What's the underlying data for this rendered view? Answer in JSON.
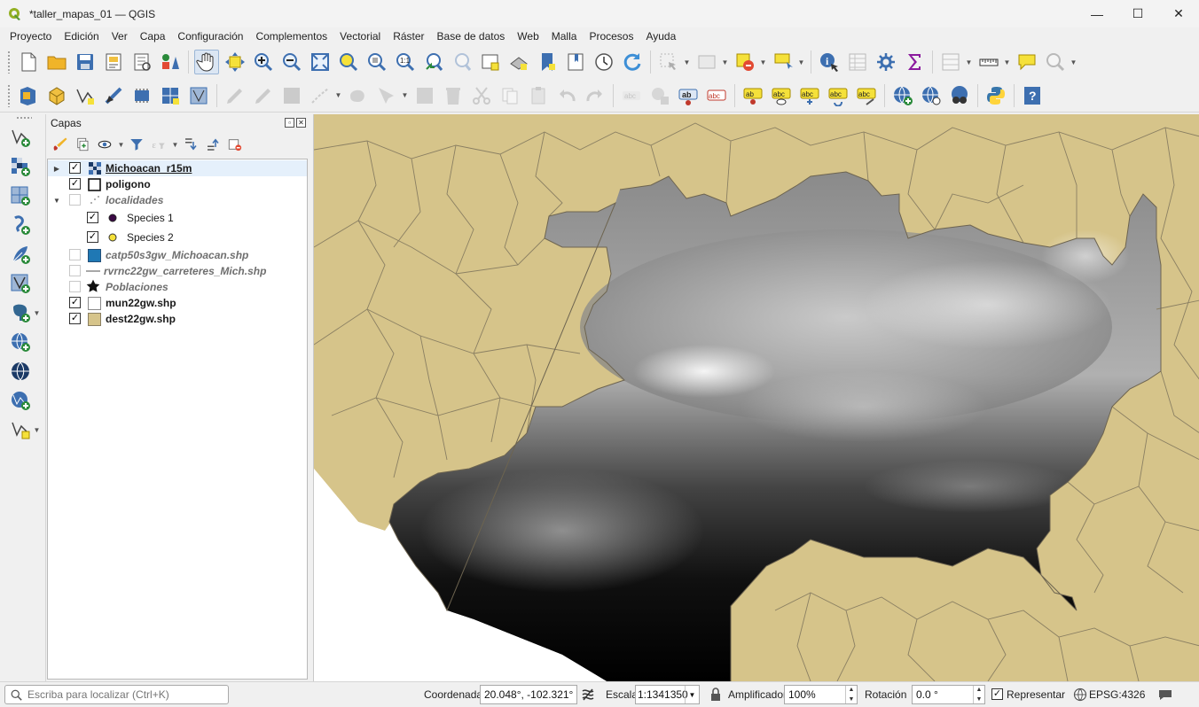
{
  "window": {
    "title": "*taller_mapas_01 — QGIS",
    "minimize": "—",
    "maximize": "☐",
    "close": "✕"
  },
  "menu": [
    "Proyecto",
    "Edición",
    "Ver",
    "Capa",
    "Configuración",
    "Complementos",
    "Vectorial",
    "Ráster",
    "Base de datos",
    "Web",
    "Malla",
    "Procesos",
    "Ayuda"
  ],
  "layers_panel": {
    "title": "Capas",
    "float_btn": "▫",
    "close_btn": "✕",
    "items": [
      {
        "name": "Michoacan_r15m",
        "checked": true,
        "style": "bold-underline",
        "symbol": "raster-icon",
        "expander": "collapsed"
      },
      {
        "name": "poligono",
        "checked": true,
        "style": "bold",
        "symbol": "empty-square-symbol"
      },
      {
        "name": "localidades",
        "checked": false,
        "style": "italic",
        "symbol": "point-cluster-symbol",
        "expander": "expanded"
      },
      {
        "name": "Species 1",
        "checked": true,
        "style": "normal",
        "symbol": "dark-purple-dot",
        "color": "#3b0a45"
      },
      {
        "name": "Species 2",
        "checked": true,
        "style": "normal",
        "symbol": "yellow-dot",
        "color": "#f5e13a"
      },
      {
        "name": "catp50s3gw_Michoacan.shp",
        "checked": false,
        "style": "italic",
        "symbol": "blue-fill-symbol",
        "color": "#1f78b4"
      },
      {
        "name": "rvrnc22gw_carreteres_Mich.shp",
        "checked": false,
        "style": "italic",
        "symbol": "line-symbol"
      },
      {
        "name": "Poblaciones",
        "checked": false,
        "style": "italic",
        "symbol": "star-symbol"
      },
      {
        "name": "mun22gw.shp",
        "checked": true,
        "style": "bold",
        "symbol": "white-fill-symbol"
      },
      {
        "name": "dest22gw.shp",
        "checked": true,
        "style": "bold",
        "symbol": "tan-fill-symbol",
        "color": "#d6c48a"
      }
    ]
  },
  "map": {
    "land_color": "#d6c48a",
    "boundary_color": "#8a7f62",
    "sea_color": "#ffffff"
  },
  "status": {
    "locator_placeholder": "Escriba para localizar (Ctrl+K)",
    "coordinate_label": "Coordenada",
    "coordinate_value": "20.048°, -102.321°",
    "scale_label": "Escala",
    "scale_value": "1:1341350",
    "magnifier_label": "Amplificador",
    "magnifier_value": "100%",
    "rotation_label": "Rotación",
    "rotation_value": "0.0 °",
    "render_label": "Representar",
    "render_checked": "✓",
    "crs": "EPSG:4326"
  },
  "checkmark": "✓"
}
